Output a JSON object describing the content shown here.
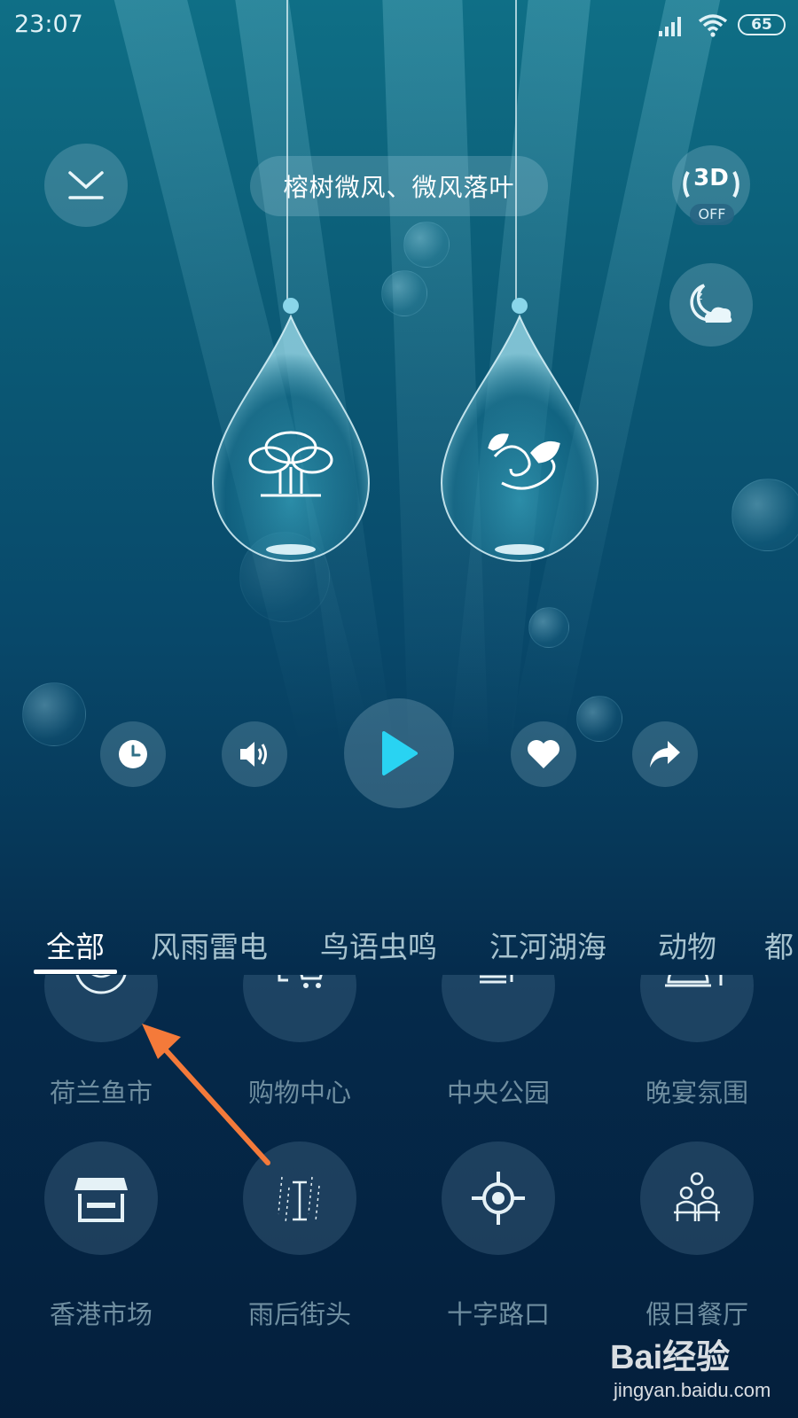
{
  "status_bar": {
    "time": "23:07",
    "battery": "65"
  },
  "header": {
    "title": "榕树微风、微风落叶",
    "toggle_3d": {
      "label": "3D",
      "state": "OFF"
    }
  },
  "drops": [
    {
      "icon": "banyan-tree-icon"
    },
    {
      "icon": "wind-leaves-icon"
    }
  ],
  "controls": {
    "timer_icon": "clock-icon",
    "volume_icon": "speaker-icon",
    "play_icon": "play-icon",
    "favorite_icon": "heart-icon",
    "share_icon": "share-icon"
  },
  "tabs": [
    {
      "label": "全部",
      "active": true
    },
    {
      "label": "风雨雷电",
      "active": false
    },
    {
      "label": "鸟语虫鸣",
      "active": false
    },
    {
      "label": "江河湖海",
      "active": false
    },
    {
      "label": "动物",
      "active": false
    },
    {
      "label": "都",
      "active": false
    }
  ],
  "scenes": [
    {
      "label": "荷兰鱼市",
      "icon": "fish-market-icon"
    },
    {
      "label": "购物中心",
      "icon": "shopping-cart-icon"
    },
    {
      "label": "中央公园",
      "icon": "park-icon"
    },
    {
      "label": "晚宴氛围",
      "icon": "dinner-cloche-icon"
    },
    {
      "label": "香港市场",
      "icon": "market-stall-icon"
    },
    {
      "label": "雨后街头",
      "icon": "rainy-street-lamp-icon"
    },
    {
      "label": "十字路口",
      "icon": "crossroad-icon"
    },
    {
      "label": "假日餐厅",
      "icon": "restaurant-people-icon"
    }
  ],
  "watermark": {
    "logo": "Bai经验",
    "url": "jingyan.baidu.com"
  },
  "colors": {
    "accent_play": "#29d3f2",
    "annotation_arrow": "#f47a3a"
  }
}
